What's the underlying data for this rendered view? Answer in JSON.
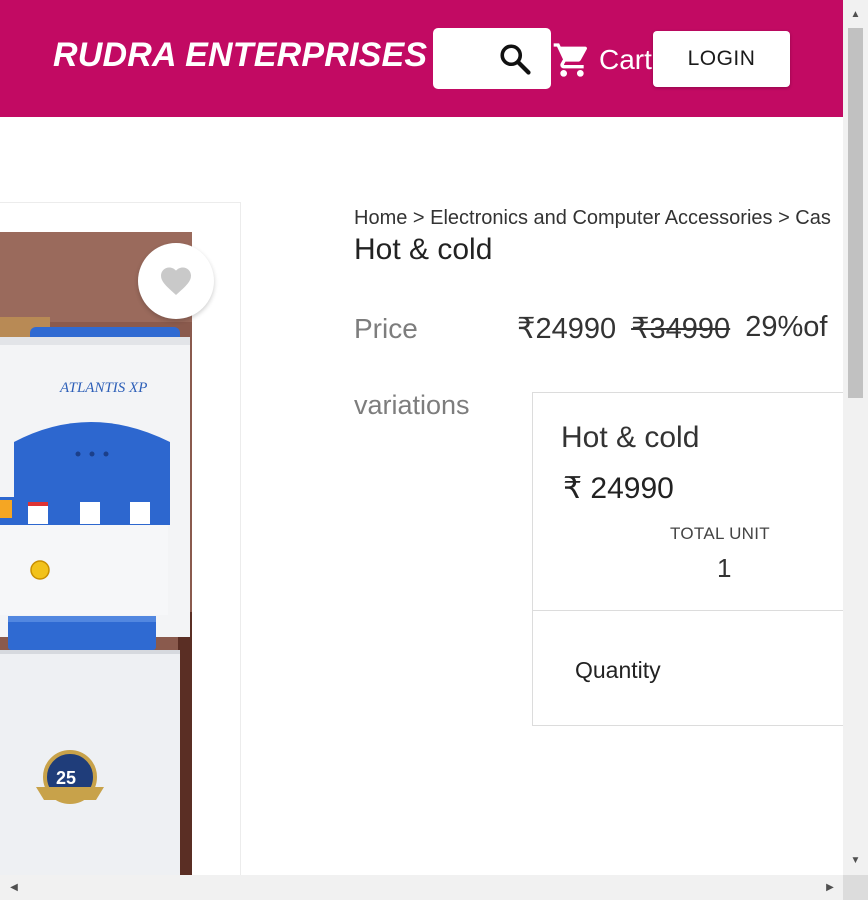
{
  "header": {
    "brand": "RUDRA ENTERPRISES",
    "search_icon": "search-icon",
    "cart_icon": "cart-icon",
    "cart_label": "Cart",
    "login_label": "LOGIN",
    "brand_color": "#c20a63"
  },
  "product": {
    "breadcrumb": "Home > Electronics and Computer Accessories > Cas",
    "title": "Hot & cold",
    "price_label": "Price",
    "price": "₹24990",
    "mrp": "₹34990",
    "discount": "29%of",
    "wishlist_icon": "heart-icon",
    "photo_brand_text": "ATLANTIS XP",
    "photo_badge_text": "25"
  },
  "variations": {
    "label": "variations",
    "items": [
      {
        "name": "Hot & cold",
        "price": "₹ 24990",
        "total_unit_label": "TOTAL UNIT",
        "total_unit_value": "1",
        "quantity_label": "Quantity"
      }
    ]
  },
  "scrollbars": {
    "up_arrow": "▲",
    "down_arrow": "▼",
    "left_arrow": "◀",
    "right_arrow": "▶"
  }
}
